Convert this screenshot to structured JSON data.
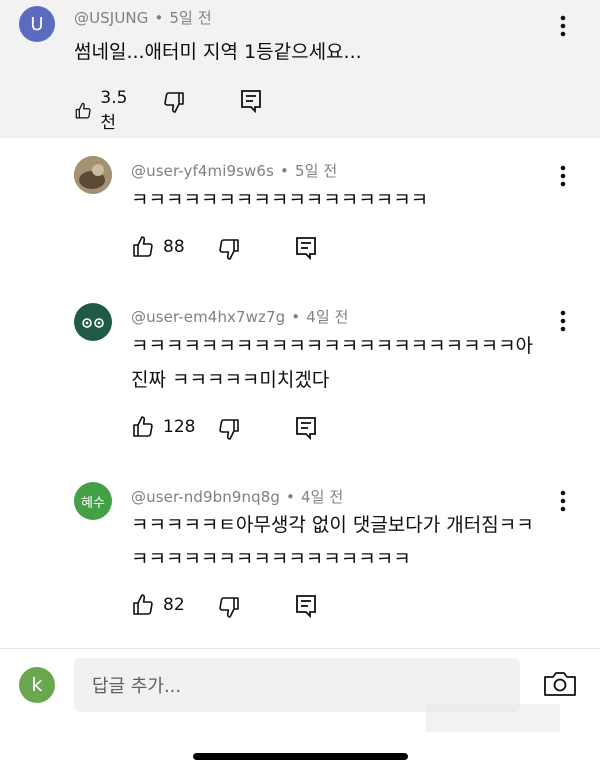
{
  "comments": [
    {
      "author": "@USJUNG",
      "age": "5일 전",
      "avatar_letter": "U",
      "avatar_color": "#5c6bc0",
      "text": "썸네일...애터미 지역 1등같으세요...",
      "likes": "3.5천"
    },
    {
      "author": "@user-yf4mi9sw6s",
      "age": "5일 전",
      "text": "ㅋㅋㅋㅋㅋㅋㅋㅋㅋㅋㅋㅋㅋㅋㅋㅋㅋ",
      "likes": "88"
    },
    {
      "author": "@user-em4hx7wz7g",
      "age": "4일 전",
      "text": "ㅋㅋㅋㅋㅋㅋㅋㅋㅋㅋㅋㅋㅋㅋㅋㅋㅋㅋㅋㅋㅋㅋ아\n진짜 ㅋㅋㅋㅋㅋ미치겠다",
      "likes": "128"
    },
    {
      "author": "@user-nd9bn9nq8g",
      "age": "4일 전",
      "avatar_text": "혜수",
      "avatar_color": "#43a047",
      "text": "ㅋㅋㅋㅋㅋㅌ아무생각 없이 댓글보다가 개터짐ㅋㅋ\nㅋㅋㅋㅋㅋㅋㅋㅋㅋㅋㅋㅋㅋㅋㅋㅋ",
      "likes": "82"
    }
  ],
  "reply": {
    "user_initial": "k",
    "user_avatar_color": "#6aa84f",
    "placeholder": "답글 추가..."
  },
  "icons": {
    "like": "thumbs-up-icon",
    "dislike": "thumbs-down-icon",
    "reply": "comment-icon",
    "more": "more-vertical-icon",
    "camera": "camera-icon"
  }
}
